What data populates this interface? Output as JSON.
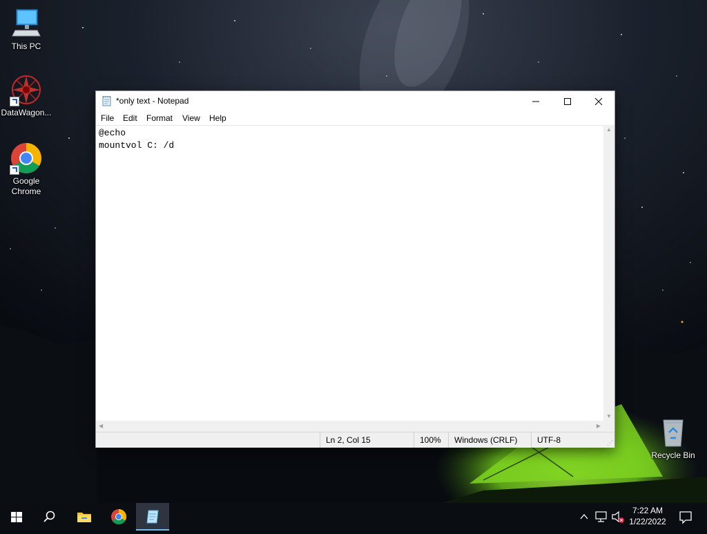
{
  "desktop": {
    "icons": [
      {
        "label": "This PC",
        "icon": "computer-icon"
      },
      {
        "label": "DataWagon...",
        "icon": "datawagon-icon"
      },
      {
        "label": "Google Chrome",
        "icon": "chrome-icon"
      },
      {
        "label": "Recycle Bin",
        "icon": "recycle-bin-icon"
      }
    ]
  },
  "notepad": {
    "title": "*only text - Notepad",
    "menu": [
      "File",
      "Edit",
      "Format",
      "View",
      "Help"
    ],
    "content": "@echo\nmountvol C: /d",
    "status": {
      "position": "Ln 2, Col 15",
      "zoom": "100%",
      "line_ending": "Windows (CRLF)",
      "encoding": "UTF-8"
    },
    "caption_buttons": [
      "minimize-icon",
      "maximize-icon",
      "close-icon"
    ]
  },
  "taskbar": {
    "items": [
      "windows-start-icon",
      "search-icon",
      "file-explorer-icon",
      "chrome-icon",
      "notepad-icon"
    ],
    "tray_icons": [
      "chevron-up-icon",
      "network-icon",
      "volume-muted-icon"
    ],
    "clock": {
      "time": "7:22 AM",
      "date": "1/22/2022"
    },
    "notification_icon": "action-center-icon"
  },
  "colors": {
    "accent": "#76b9ed",
    "taskbar": "#0a0d12",
    "tent_green": "#7ed321"
  }
}
